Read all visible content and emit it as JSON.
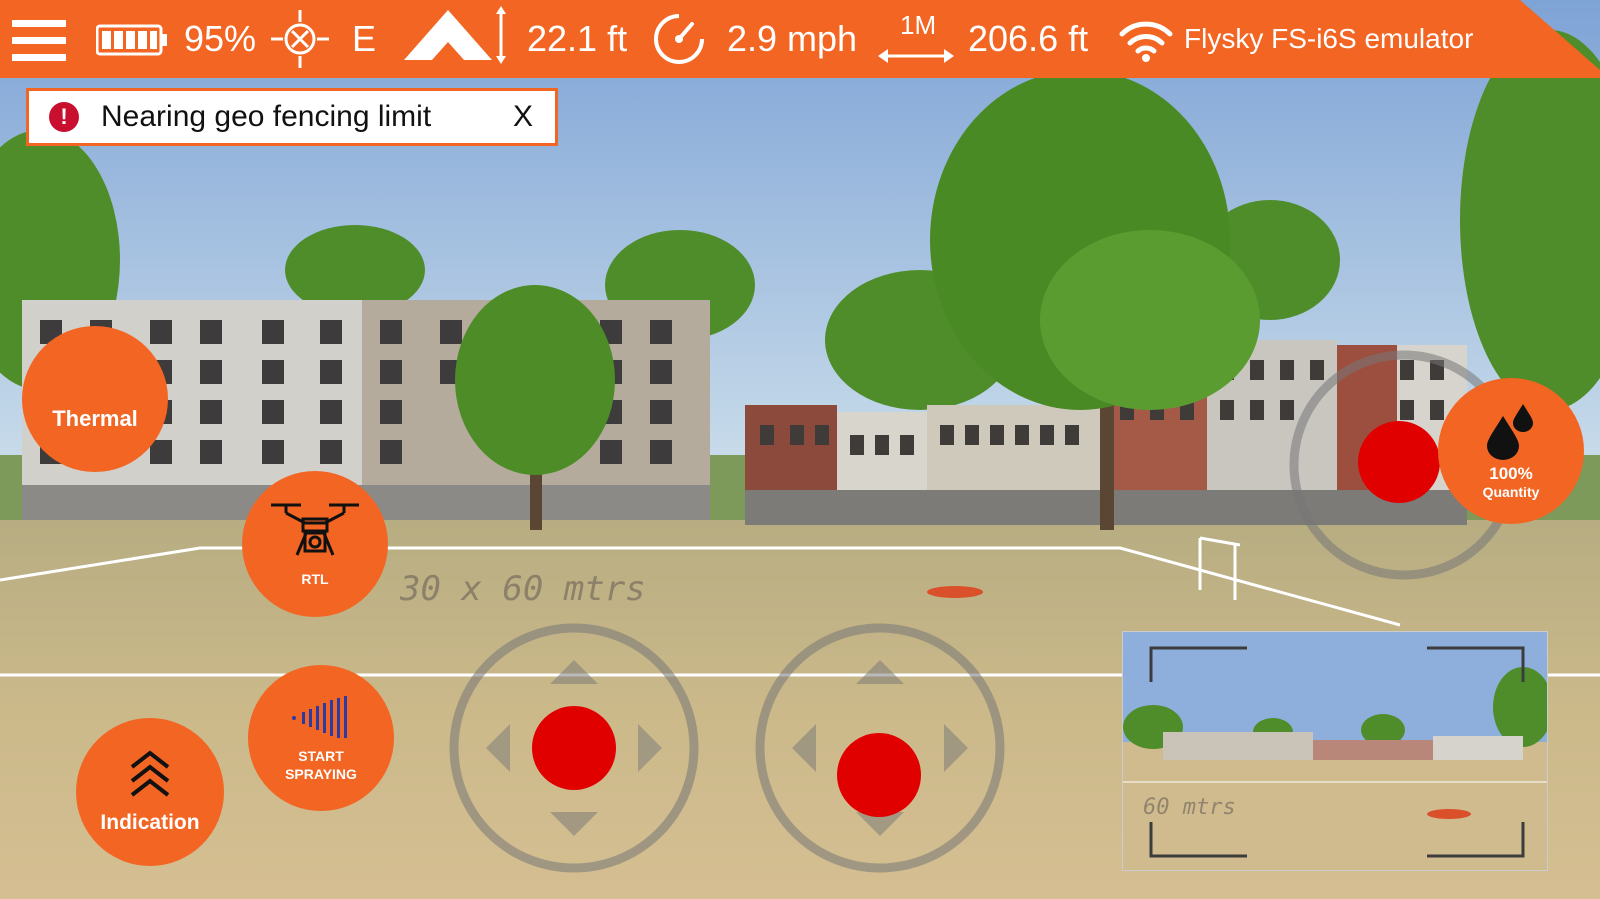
{
  "colors": {
    "accent": "#f26522",
    "alert": "#c8102e",
    "joystick_knob": "#e00000"
  },
  "topbar": {
    "menu_icon": "hamburger-icon",
    "battery_icon": "battery-icon",
    "battery": "95%",
    "gps_icon": "crosshair-icon",
    "heading": "E",
    "altitude_icon": "mountain-altitude-icon",
    "altitude": "22.1 ft",
    "speed_icon": "speedometer-icon",
    "speed": "2.9 mph",
    "distance_scale": "1M",
    "distance": "206.6 ft",
    "signal_icon": "wifi-icon",
    "controller": "Flysky FS-i6S emulator"
  },
  "alert": {
    "icon": "exclamation-icon",
    "message": "Nearing geo fencing limit",
    "close": "X"
  },
  "buttons": {
    "thermal": "Thermal",
    "rtl": "RTL",
    "start_spraying_line1": "START",
    "start_spraying_line2": "SPRAYING",
    "indication": "Indication",
    "quantity_percent": "100%",
    "quantity_label": "Quantity"
  },
  "scene": {
    "field_text": "30 x 60 mtrs",
    "pip_field_text": "60 mtrs"
  }
}
